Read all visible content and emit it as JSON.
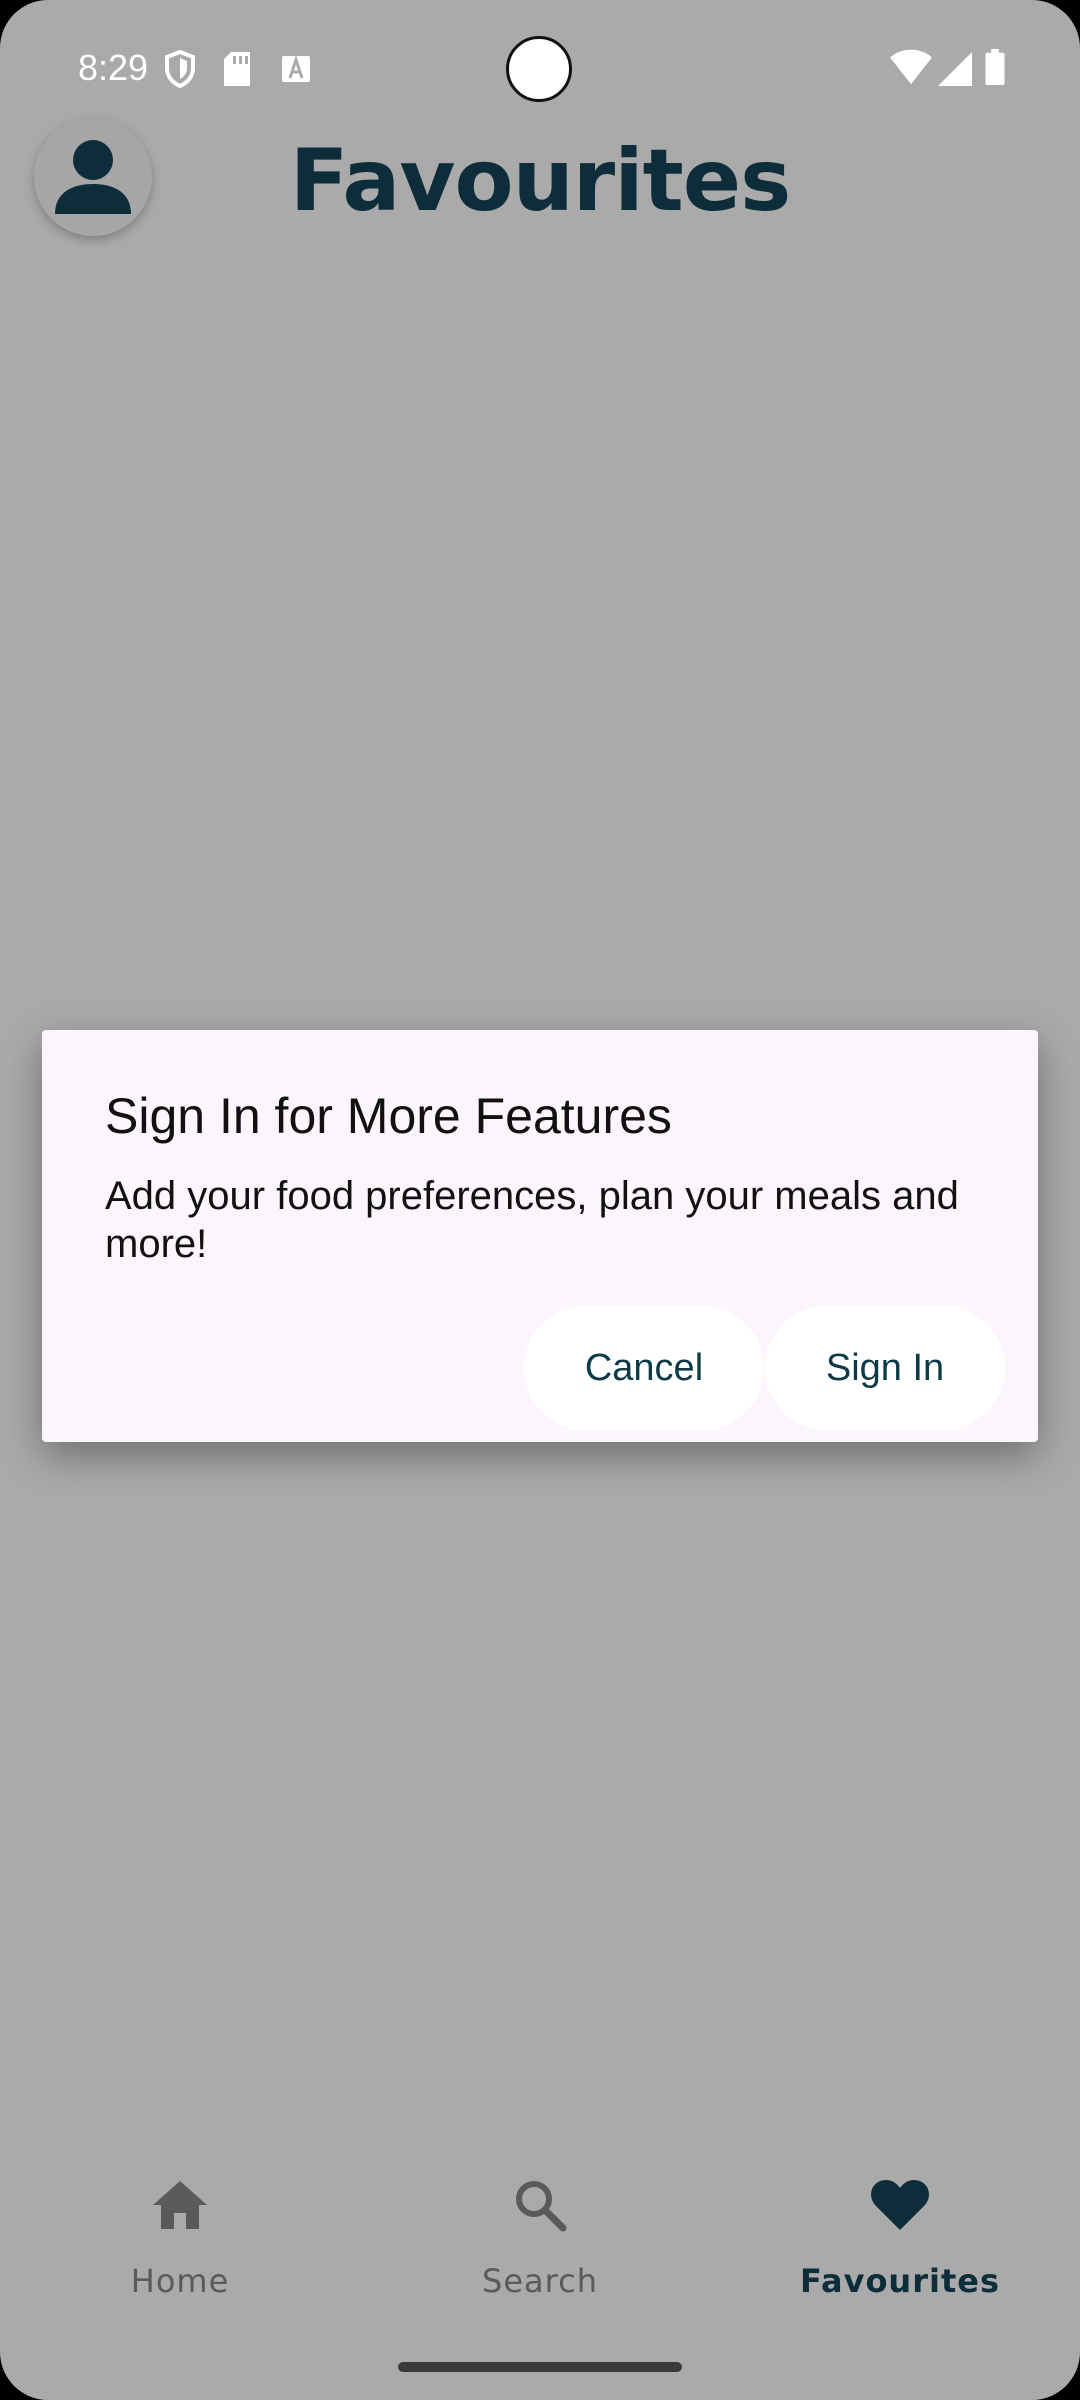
{
  "status_bar": {
    "time": "8:29",
    "icons": [
      "shield-icon",
      "sd-card-icon",
      "a-badge-icon",
      "wifi-icon",
      "signal-icon",
      "battery-icon"
    ]
  },
  "header": {
    "title": "Favourites",
    "avatar_icon": "account-icon"
  },
  "dialog": {
    "title": "Sign In for More Features",
    "body": "Add your food preferences, plan your meals and more!",
    "cancel_label": "Cancel",
    "signin_label": "Sign In"
  },
  "bottom_nav": {
    "items": [
      {
        "label": "Home",
        "icon": "home-icon",
        "active": false
      },
      {
        "label": "Search",
        "icon": "search-icon",
        "active": false
      },
      {
        "label": "Favourites",
        "icon": "heart-icon",
        "active": true
      }
    ]
  },
  "colors": {
    "scrim": "#aaaaaa",
    "brand_dark": "#0d2d3a",
    "dialog_bg": "#fcf5fc",
    "button_text": "#0d3a48"
  }
}
